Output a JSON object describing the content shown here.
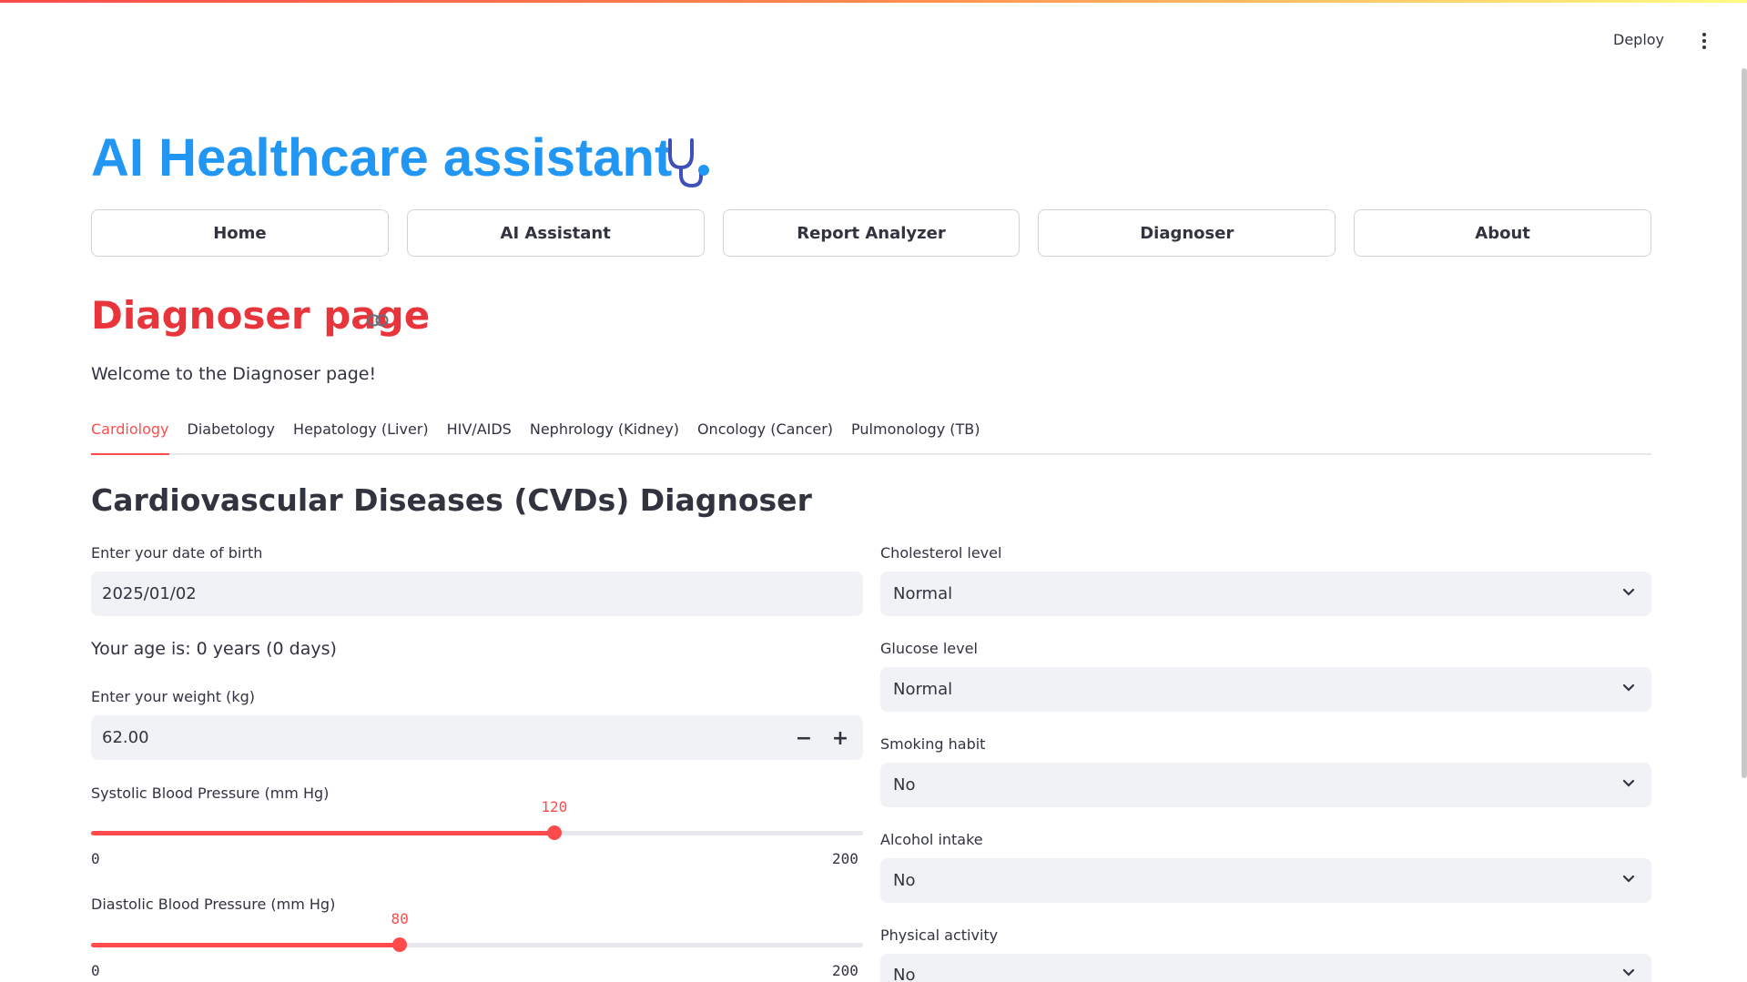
{
  "header": {
    "deploy_label": "Deploy",
    "menu_icon": "kebab-menu-icon"
  },
  "app": {
    "title": "AI Healthcare assistant",
    "title_icon": "stethoscope-icon",
    "accent": "#2196f3"
  },
  "nav": {
    "items": [
      {
        "label": "Home"
      },
      {
        "label": "AI Assistant"
      },
      {
        "label": "Report Analyzer"
      },
      {
        "label": "Diagnoser"
      },
      {
        "label": "About"
      }
    ]
  },
  "page": {
    "title": "Diagnoser page",
    "title_color": "#e8353b",
    "welcome": "Welcome to the Diagnoser page!"
  },
  "tabs": {
    "active": 0,
    "items": [
      {
        "label": "Cardiology"
      },
      {
        "label": "Diabetology"
      },
      {
        "label": "Hepatology (Liver)"
      },
      {
        "label": "HIV/AIDS"
      },
      {
        "label": "Nephrology (Kidney)"
      },
      {
        "label": "Oncology (Cancer)"
      },
      {
        "label": "Pulmonology (TB)"
      }
    ]
  },
  "form": {
    "section_title": "Cardiovascular Diseases (CVDs) Diagnoser",
    "dob": {
      "label": "Enter your date of birth",
      "value": "2025/01/02"
    },
    "age_text": "Your age is: 0 years (0 days)",
    "weight": {
      "label": "Enter your weight (kg)",
      "value": "62.00"
    },
    "systolic": {
      "label": "Systolic Blood Pressure (mm Hg)",
      "value": 120,
      "min": 0,
      "max": 200,
      "value_label": "120",
      "min_label": "0",
      "max_label": "200"
    },
    "diastolic": {
      "label": "Diastolic Blood Pressure (mm Hg)",
      "value": 80,
      "min": 0,
      "max": 200,
      "value_label": "80",
      "min_label": "0",
      "max_label": "200"
    },
    "cholesterol": {
      "label": "Cholesterol level",
      "value": "Normal"
    },
    "glucose": {
      "label": "Glucose level",
      "value": "Normal"
    },
    "smoking": {
      "label": "Smoking habit",
      "value": "No"
    },
    "alcohol": {
      "label": "Alcohol intake",
      "value": "No"
    },
    "activity": {
      "label": "Physical activity",
      "value": "No"
    }
  }
}
